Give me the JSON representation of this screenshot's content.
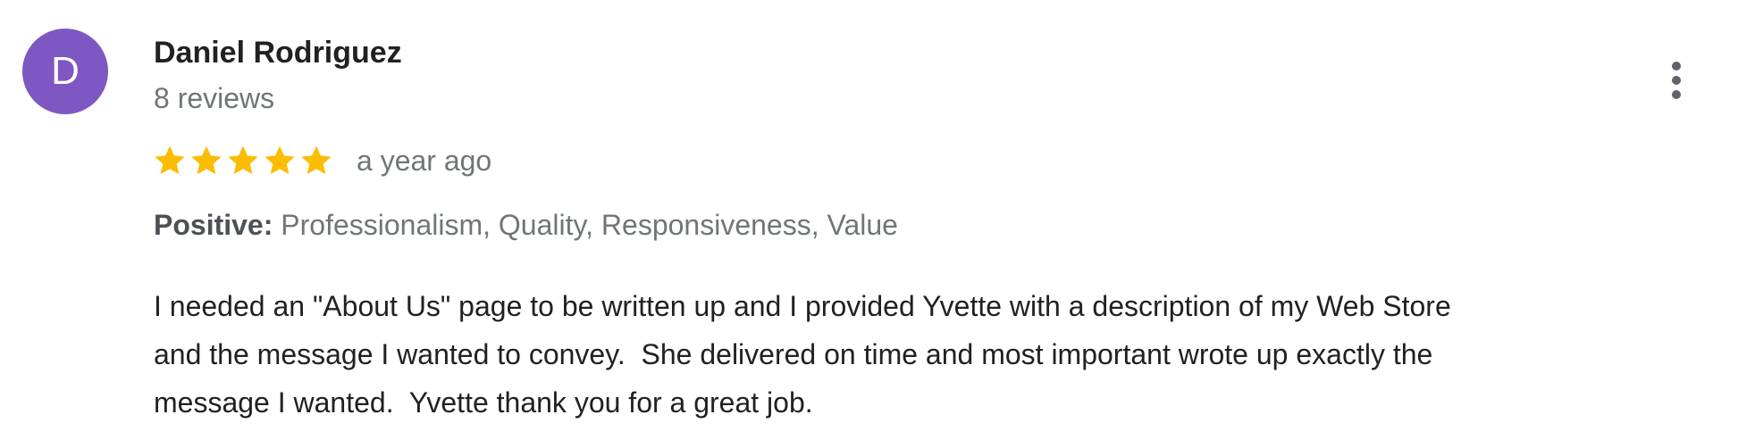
{
  "review": {
    "avatar_letter": "D",
    "avatar_color": "#7e57c2",
    "reviewer_name": "Daniel Rodriguez",
    "review_count": "8 reviews",
    "rating": 5,
    "rating_max": 5,
    "star_color": "#fbbc04",
    "time_ago": "a year ago",
    "positive_label": "Positive:",
    "positive_values": " Professionalism, Quality, Responsiveness, Value",
    "text_lines": [
      "I needed an \"About Us\" page to be written up and I provided Yvette with a description of my Web Store",
      "and the message I wanted to convey.  She delivered on time and most important wrote up exactly the",
      "message I wanted.  Yvette thank you for a great job."
    ]
  },
  "menu": {
    "icon": "more-vert-icon"
  }
}
